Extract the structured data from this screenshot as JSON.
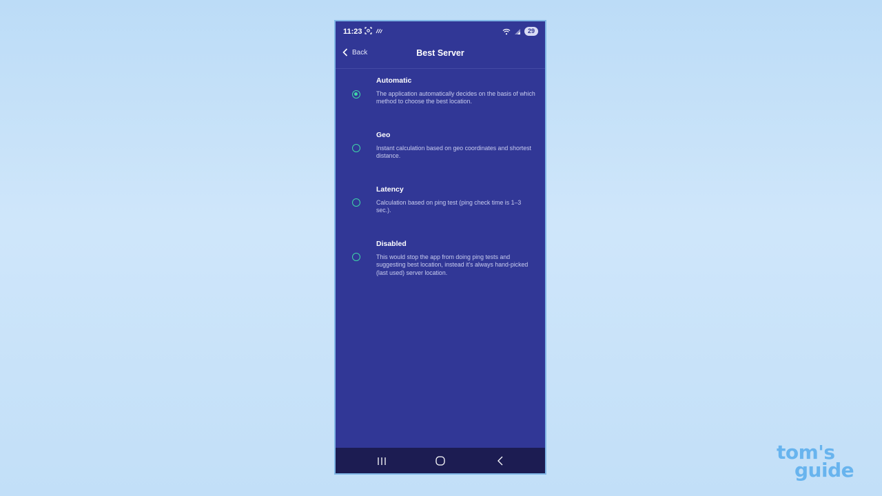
{
  "status_bar": {
    "time": "11:23",
    "battery": "29"
  },
  "header": {
    "back_label": "Back",
    "title": "Best Server"
  },
  "options": [
    {
      "title": "Automatic",
      "description": "The application automatically decides on the basis of which method to choose the best location.",
      "selected": true
    },
    {
      "title": "Geo",
      "description": "Instant calculation based on geo coordinates and shortest distance.",
      "selected": false
    },
    {
      "title": "Latency",
      "description": "Calculation based on ping test (ping check time is 1–3 sec.).",
      "selected": false
    },
    {
      "title": "Disabled",
      "description": "This would stop the app from doing ping tests and suggesting best location, instead it's always hand-picked (last used) server location.",
      "selected": false
    }
  ],
  "watermark": {
    "line1": "tom's",
    "line2": "guide"
  },
  "colors": {
    "background": "#313796",
    "accent": "#3fd6a7",
    "nav_bar": "#1c1c52"
  },
  "icons": {
    "back": "chevron-left-icon",
    "recent_apps": "recent-apps-icon",
    "home": "home-icon",
    "nav_back": "nav-back-icon"
  }
}
